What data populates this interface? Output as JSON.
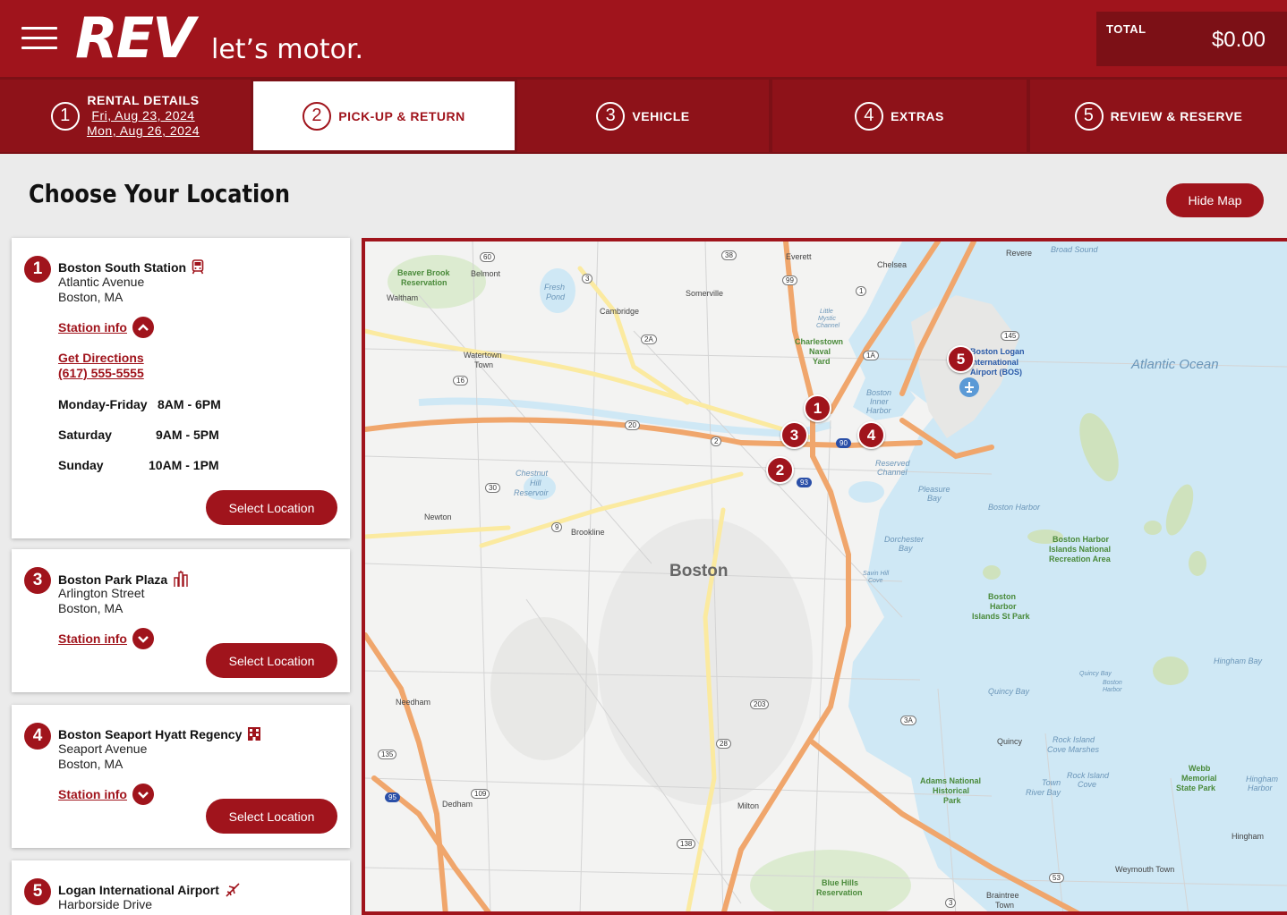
{
  "header": {
    "logo_rev": "REV",
    "logo_tagline": "let’s motor.",
    "total_label": "TOTAL",
    "total_value": "$0.00"
  },
  "steps": [
    {
      "num": "1",
      "label": "RENTAL DETAILS",
      "date1": "Fri, Aug 23, 2024",
      "date2": "Mon, Aug 26, 2024"
    },
    {
      "num": "2",
      "label": "PICK-UP & RETURN"
    },
    {
      "num": "3",
      "label": "VEHICLE"
    },
    {
      "num": "4",
      "label": "EXTRAS"
    },
    {
      "num": "5",
      "label": "REVIEW & RESERVE"
    }
  ],
  "page": {
    "title": "Choose Your Location",
    "hide_map": "Hide Map"
  },
  "locations": [
    {
      "num": "1",
      "name": "Boston South Station",
      "icon": "train-icon",
      "street": "Atlantic Avenue",
      "city": "Boston, MA",
      "station_info": "Station info",
      "directions": "Get Directions",
      "phone": "(617) 555-5555",
      "hours": [
        {
          "day": "Monday-Friday",
          "time": "8AM - 6PM"
        },
        {
          "day": "Saturday",
          "time": "9AM - 5PM"
        },
        {
          "day": "Sunday",
          "time": "10AM - 1PM"
        }
      ],
      "select": "Select Location"
    },
    {
      "num": "3",
      "name": "Boston Park Plaza",
      "icon": "city-icon",
      "street": "Arlington Street",
      "city": "Boston, MA",
      "station_info": "Station info",
      "select": "Select Location"
    },
    {
      "num": "4",
      "name": "Boston Seaport Hyatt Regency",
      "icon": "hotel-icon",
      "street": "Seaport Avenue",
      "city": "Boston, MA",
      "station_info": "Station info",
      "select": "Select Location"
    },
    {
      "num": "5",
      "name": "Logan International Airport",
      "icon": "airplane-icon",
      "street": "Harborside Drive"
    }
  ],
  "map": {
    "pins": [
      "1",
      "2",
      "3",
      "4",
      "5"
    ],
    "city_label": "Boston",
    "ocean_label": "Atlantic Ocean",
    "labels": {
      "everett": "Everett",
      "chelsea": "Chelsea",
      "revere": "Revere",
      "broad_sound": "Broad Sound",
      "beaver_brook": "Beaver Brook",
      "reservation": "Reservation",
      "belmont": "Belmont",
      "waltham": "Waltham",
      "fresh": "Fresh",
      "pond": "Pond",
      "somerville": "Somerville",
      "cambridge": "Cambridge",
      "charlestown": "Charlestown",
      "naval": "Naval",
      "yard": "Yard",
      "watertown": "Watertown",
      "town": "Town",
      "logan1": "Boston Logan",
      "logan2": "International",
      "logan3": "Airport (BOS)",
      "inner1": "Boston",
      "inner2": "Inner",
      "inner3": "Harbor",
      "reserved1": "Reserved",
      "reserved2": "Channel",
      "chestnut1": "Chestnut",
      "chestnut2": "Hill",
      "chestnut3": "Reservoir",
      "pleasure1": "Pleasure",
      "pleasure2": "Bay",
      "newton": "Newton",
      "brookline": "Brookline",
      "boston_harbor": "Boston Harbor",
      "bhinr1": "Boston Harbor",
      "bhinr2": "Islands National",
      "bhinr3": "Recreation Area",
      "dorchester1": "Dorchester",
      "dorchester2": "Bay",
      "bhisp1": "Boston",
      "bhisp2": "Harbor",
      "bhisp3": "Islands St Park",
      "savin1": "Savin Hill",
      "savin2": "Cove",
      "hingham_bay": "Hingham Bay",
      "quincy_bay_small": "Quincy Bay",
      "boston_harbor_small1": "Boston",
      "boston_harbor_small2": "Harbor",
      "quincy_bay": "Quincy Bay",
      "needham": "Needham",
      "quincy": "Quincy",
      "rock1": "Rock Island",
      "rock2": "Cove Marshes",
      "rock3": "Rock Island",
      "rock4": "Cove",
      "town_river1": "Town",
      "town_river2": "River Bay",
      "adams1": "Adams National",
      "adams2": "Historical",
      "adams3": "Park",
      "webb1": "Webb",
      "webb2": "Memorial",
      "webb3": "State Park",
      "hingham_harbor1": "Hingham",
      "hingham_harbor2": "Harbor",
      "dedham": "Dedham",
      "milton": "Milton",
      "hingham": "Hingham",
      "blue1": "Blue Hills",
      "blue2": "Reservation",
      "weymouth": "Weymouth Town",
      "braintree1": "Braintree",
      "braintree2": "Town",
      "little1": "Little",
      "little2": "Mystic",
      "little3": "Channel"
    },
    "shields": {
      "r60": "60",
      "r38": "38",
      "r3a": "3",
      "r99": "99",
      "r1": "1",
      "r2a": "2A",
      "r1a": "1A",
      "r145": "145",
      "r16": "16",
      "r20": "20",
      "r2": "2",
      "r90": "90",
      "r93": "93",
      "r30": "30",
      "r9": "9",
      "r203": "203",
      "r3A": "3A",
      "r28": "28",
      "r135": "135",
      "r109": "109",
      "r95": "95",
      "r138": "138",
      "r53": "53",
      "r3b": "3"
    }
  }
}
